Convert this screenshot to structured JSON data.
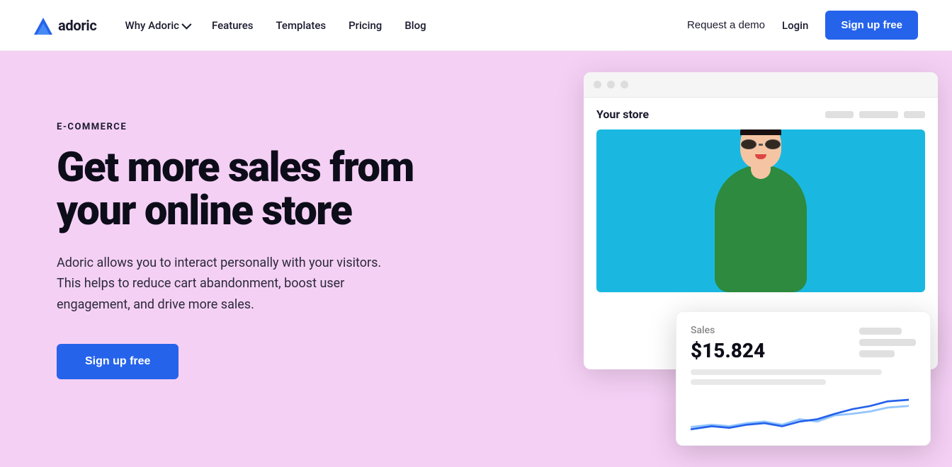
{
  "navbar": {
    "logo_text": "adoric",
    "nav_links": [
      {
        "label": "Why Adoric",
        "has_chevron": true
      },
      {
        "label": "Features",
        "has_chevron": false
      },
      {
        "label": "Templates",
        "has_chevron": false
      },
      {
        "label": "Pricing",
        "has_chevron": false
      },
      {
        "label": "Blog",
        "has_chevron": false
      }
    ],
    "request_demo": "Request a demo",
    "login": "Login",
    "signup": "Sign up free"
  },
  "hero": {
    "eyebrow": "E-COMMERCE",
    "title": "Get more sales from your online store",
    "description": "Adoric allows you to interact personally with your visitors. This helps to reduce cart abandonment, boost user engagement, and drive more sales.",
    "cta": "Sign up free",
    "store_label": "Your store",
    "analytics_title": "Sales",
    "analytics_value": "$15.824"
  },
  "colors": {
    "hero_bg": "#f5d0f5",
    "accent_blue": "#2563eb",
    "store_bg": "#1ab8e0"
  }
}
